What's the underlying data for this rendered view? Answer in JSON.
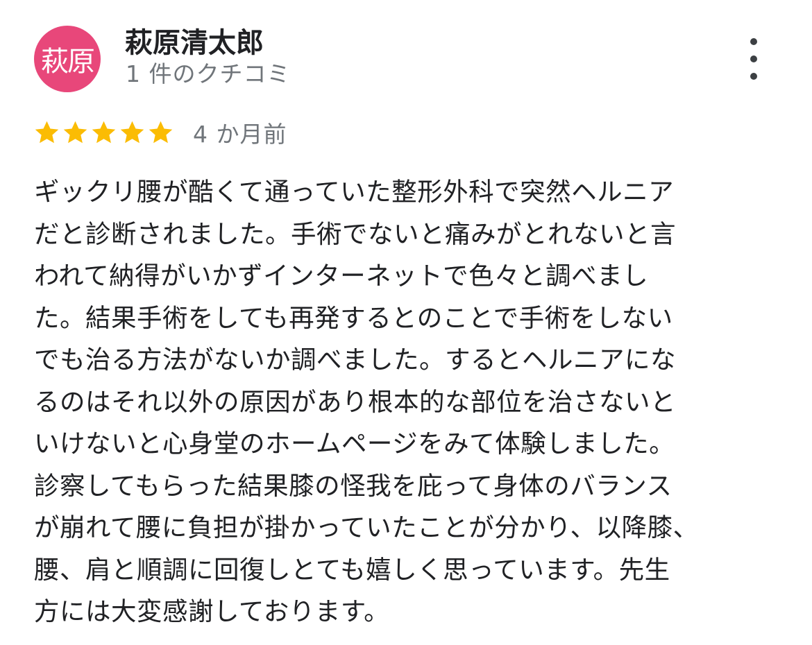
{
  "reviewer": {
    "avatar_text": "萩原",
    "avatar_color": "#e8477a",
    "name": "萩原清太郎",
    "review_count": "1 件のクチコミ"
  },
  "review": {
    "rating": 5,
    "rating_max": 5,
    "star_color": "#fbbc04",
    "date": "4 か月前",
    "text_lines": [
      "ギックリ腰が酷くて通っていた整形外科で突然ヘルニア",
      "だと診断されました。手術でないと痛みがとれないと言",
      "われて納得がいかずインターネットで色々と調べまし",
      "た。結果手術をしても再発するとのことで手術をしない",
      "でも治る方法がないか調べました。するとヘルニアにな",
      "るのはそれ以外の原因があり根本的な部位を治さないと",
      "いけないと心身堂のホームページをみて体験しました。",
      "診察してもらった結果膝の怪我を庇って身体のバランス",
      "が崩れて腰に負担が掛かっていたことが分かり、以降膝、",
      "腰、肩と順調に回復しとても嬉しく思っています。先生",
      "方には大変感謝しております。"
    ]
  },
  "menu": {
    "icon": "more-vert-icon"
  }
}
